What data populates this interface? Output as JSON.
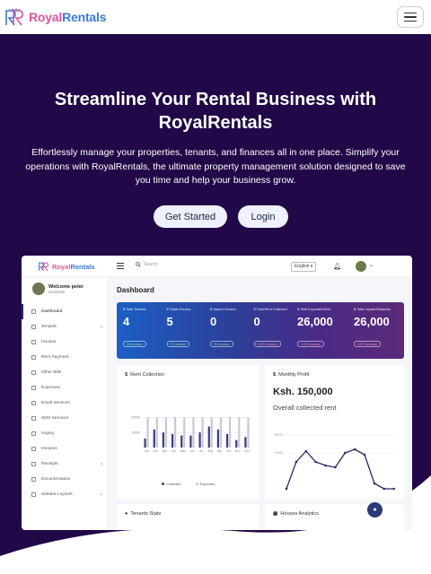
{
  "header": {
    "brand_left": "Royal",
    "brand_right": "Rentals",
    "logo_icon": "rr-monogram-icon",
    "menu_icon": "hamburger-icon"
  },
  "hero": {
    "title": "Streamline Your Rental Business with RoyalRentals",
    "subtitle": "Effortlessly manage your properties, tenants, and finances all in one place. Simplify your operations with RoyalRentals, the ultimate property management solution designed to save you time and help your business grow.",
    "cta_primary": "Get Started",
    "cta_secondary": "Login",
    "colors": {
      "background": "#220848",
      "button": "#eef1fb"
    }
  },
  "preview": {
    "brand_left": "Royal",
    "brand_right": "Rentals",
    "search_placeholder": "Search",
    "language": "English",
    "user": {
      "greeting": "Welcome peter",
      "role": "landlords"
    },
    "nav": [
      {
        "label": "Dashboard",
        "active": true,
        "has_children": false
      },
      {
        "label": "Tenants",
        "active": false,
        "has_children": true
      },
      {
        "label": "Houses",
        "active": false,
        "has_children": false
      },
      {
        "label": "Rent Payment",
        "active": false,
        "has_children": false
      },
      {
        "label": "Other Bills",
        "active": false,
        "has_children": false
      },
      {
        "label": "Expenses",
        "active": false,
        "has_children": false
      },
      {
        "label": "Email Services",
        "active": false,
        "has_children": false
      },
      {
        "label": "SMS Services",
        "active": false,
        "has_children": false
      },
      {
        "label": "Inquiry",
        "active": false,
        "has_children": false
      },
      {
        "label": "Invoices",
        "active": false,
        "has_children": false
      },
      {
        "label": "Receipts",
        "active": false,
        "has_children": true
      },
      {
        "label": "Documentation",
        "active": false,
        "has_children": false
      },
      {
        "label": "Sidebar Layouts",
        "active": false,
        "has_children": true
      }
    ],
    "page_title": "Dashboard",
    "stats": [
      {
        "label": "Total Tenants",
        "value": "4",
        "pill": "0% increase",
        "positive": true
      },
      {
        "label": "Totals Houses",
        "value": "5",
        "pill": "0% increase",
        "positive": true
      },
      {
        "label": "Vacant Houses",
        "value": "0",
        "pill": "0% increase",
        "positive": true
      },
      {
        "label": "Total Rent Collected",
        "value": "0",
        "pill": "100% decrease",
        "positive": false
      },
      {
        "label": "Total Expected Rent",
        "value": "26,000",
        "pill": "100% decrease",
        "positive": false
      },
      {
        "label": "Total Unpaid Balances",
        "value": "26,000",
        "pill": "100% decrease",
        "positive": false
      }
    ],
    "rent_card": {
      "title": "Rent Collection",
      "legend_collected": "Collected",
      "legend_expected": "Expected"
    },
    "profit_card": {
      "title": "Monthly Profit",
      "value": "Ksh. 150,000",
      "subtitle": "Overall collected rent"
    },
    "tenants_card": {
      "title": "Tenants Stats"
    },
    "houses_card": {
      "title": "Houses Analytics"
    }
  },
  "chart_data": [
    {
      "type": "bar",
      "categories": [
        "Jan",
        "Feb",
        "Mar",
        "Apr",
        "May",
        "Jun",
        "Jul",
        "Aug",
        "Sep",
        "Oct",
        "Nov",
        "Dec"
      ],
      "series": [
        {
          "name": "Collected",
          "values": [
            6000,
            12000,
            10000,
            9000,
            8000,
            8000,
            10000,
            14000,
            12000,
            9000,
            5000,
            7000
          ]
        },
        {
          "name": "Expected",
          "values": [
            20000,
            20000,
            20000,
            20000,
            20000,
            20000,
            20000,
            20000,
            20000,
            20000,
            20000,
            20000
          ]
        }
      ],
      "ylim": [
        0,
        25000
      ],
      "ytick_labels": [
        "20000",
        "10000"
      ],
      "colors": {
        "Collected": "#3a3a78",
        "Expected": "#c8c8d8"
      }
    },
    {
      "type": "line",
      "categories": [
        "Jan",
        "Feb",
        "Mar",
        "Apr",
        "May",
        "Jun",
        "Jul",
        "Aug",
        "Sep",
        "Oct",
        "Nov",
        "Dec"
      ],
      "series": [
        {
          "values": [
            0,
            15000,
            21000,
            15000,
            13000,
            12000,
            20000,
            22000,
            19000,
            3000,
            0,
            0
          ]
        }
      ],
      "ylim": [
        0,
        30000
      ],
      "ytick_labels": [
        "30000",
        "20000"
      ],
      "colors": {
        "line": "#2e2a66"
      }
    }
  ]
}
